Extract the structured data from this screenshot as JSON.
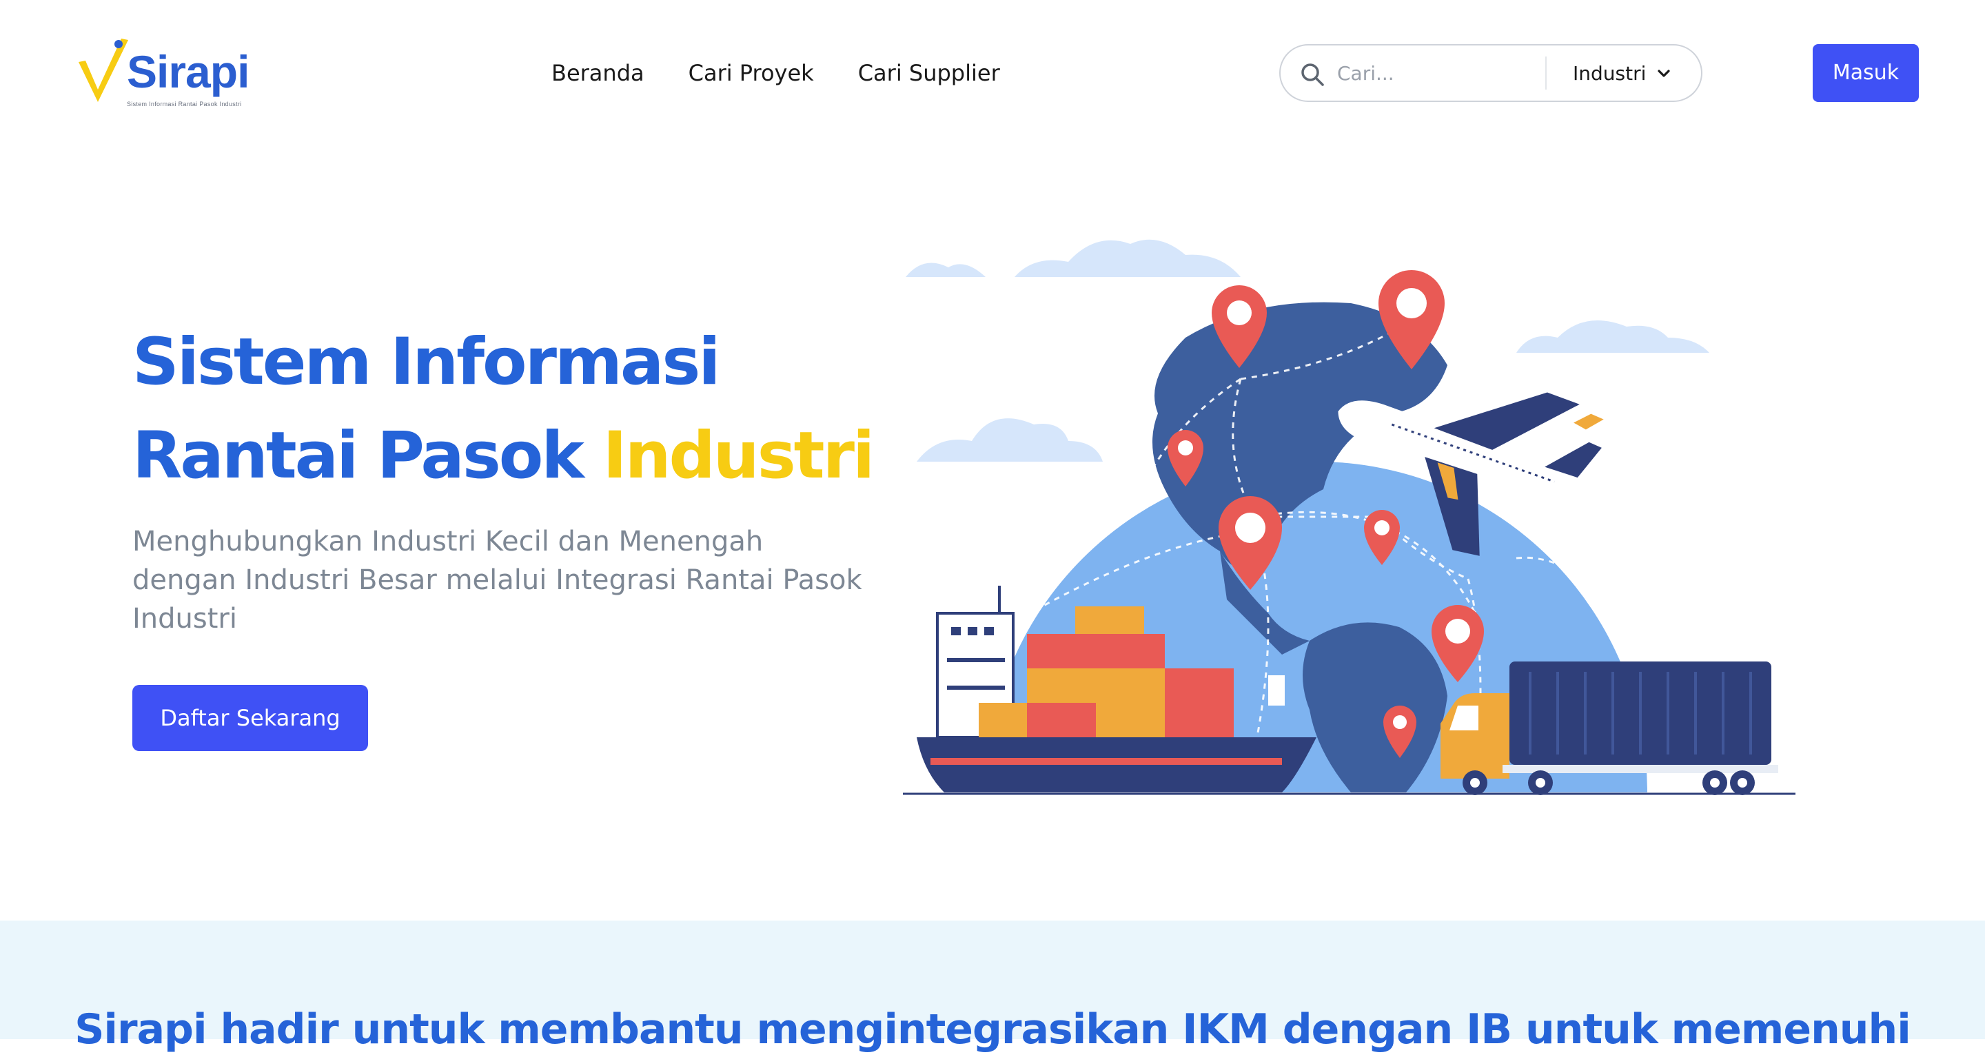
{
  "brand": {
    "name": "Sirapi",
    "tagline": "Sistem Informasi Rantai Pasok Industri",
    "colors": {
      "primary_blue": "#2563d8",
      "accent_yellow": "#f7cc13",
      "button": "#3f51f5"
    }
  },
  "nav": {
    "items": [
      {
        "label": "Beranda"
      },
      {
        "label": "Cari Proyek"
      },
      {
        "label": "Cari Supplier"
      }
    ]
  },
  "search": {
    "placeholder": "Cari...",
    "value": "",
    "icon": "search-icon",
    "category": {
      "selected": "Industri",
      "icon": "chevron-down-icon"
    }
  },
  "auth": {
    "login_label": "Masuk"
  },
  "hero": {
    "title_line1": "Sistem Informasi",
    "title_line2": "Rantai Pasok",
    "title_accent": "Industri",
    "subtitle": "Menghubungkan Industri Kecil dan Menengah dengan Industri Besar melalui Integrasi Rantai Pasok Industri",
    "cta_label": "Daftar Sekarang"
  },
  "about": {
    "heading": "Sirapi hadir untuk membantu mengintegrasikan IKM dengan IB untuk memenuhi"
  }
}
